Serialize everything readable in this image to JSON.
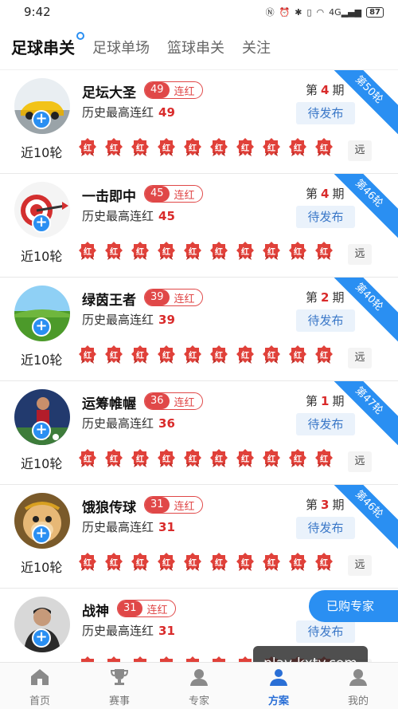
{
  "status_bar": {
    "time": "9:42",
    "signal": "4G",
    "battery": "87"
  },
  "tabs": [
    {
      "label": "足球串关",
      "active": true
    },
    {
      "label": "足球单场",
      "active": false
    },
    {
      "label": "篮球串关",
      "active": false
    },
    {
      "label": "关注",
      "active": false
    }
  ],
  "labels": {
    "streak_suffix": "连红",
    "history_prefix": "历史最高连红",
    "period_prefix": "第",
    "period_suffix": "期",
    "pending": "待发布",
    "recent": "近10轮",
    "badge": "红",
    "far": "远"
  },
  "experts": [
    {
      "name": "足坛大圣",
      "streak": "49",
      "history": "49",
      "period": "4",
      "ribbon": "第50轮",
      "avatar": "car"
    },
    {
      "name": "一击即中",
      "streak": "45",
      "history": "45",
      "period": "4",
      "ribbon": "第46轮",
      "avatar": "dart"
    },
    {
      "name": "绿茵王者",
      "streak": "39",
      "history": "39",
      "period": "2",
      "ribbon": "第40轮",
      "avatar": "field"
    },
    {
      "name": "运筹帷幄",
      "streak": "36",
      "history": "36",
      "period": "1",
      "ribbon": "第47轮",
      "avatar": "player"
    },
    {
      "name": "饿狼传球",
      "streak": "31",
      "history": "31",
      "period": "3",
      "ribbon": "第46轮",
      "avatar": "monkey"
    },
    {
      "name": "战神",
      "streak": "31",
      "history": "31",
      "period": "",
      "ribbon": "",
      "avatar": "man"
    }
  ],
  "floating": {
    "purchased": "已购专家",
    "watermark": "play-kxty.com"
  },
  "bottom_nav": [
    {
      "label": "首页",
      "icon": "home-icon",
      "active": false
    },
    {
      "label": "赛事",
      "icon": "trophy-icon",
      "active": false
    },
    {
      "label": "专家",
      "icon": "expert-icon",
      "active": false
    },
    {
      "label": "方案",
      "icon": "plan-icon",
      "active": true
    },
    {
      "label": "我的",
      "icon": "profile-icon",
      "active": false
    }
  ],
  "colors": {
    "accent": "#2a8ff2",
    "red": "#e04848"
  }
}
